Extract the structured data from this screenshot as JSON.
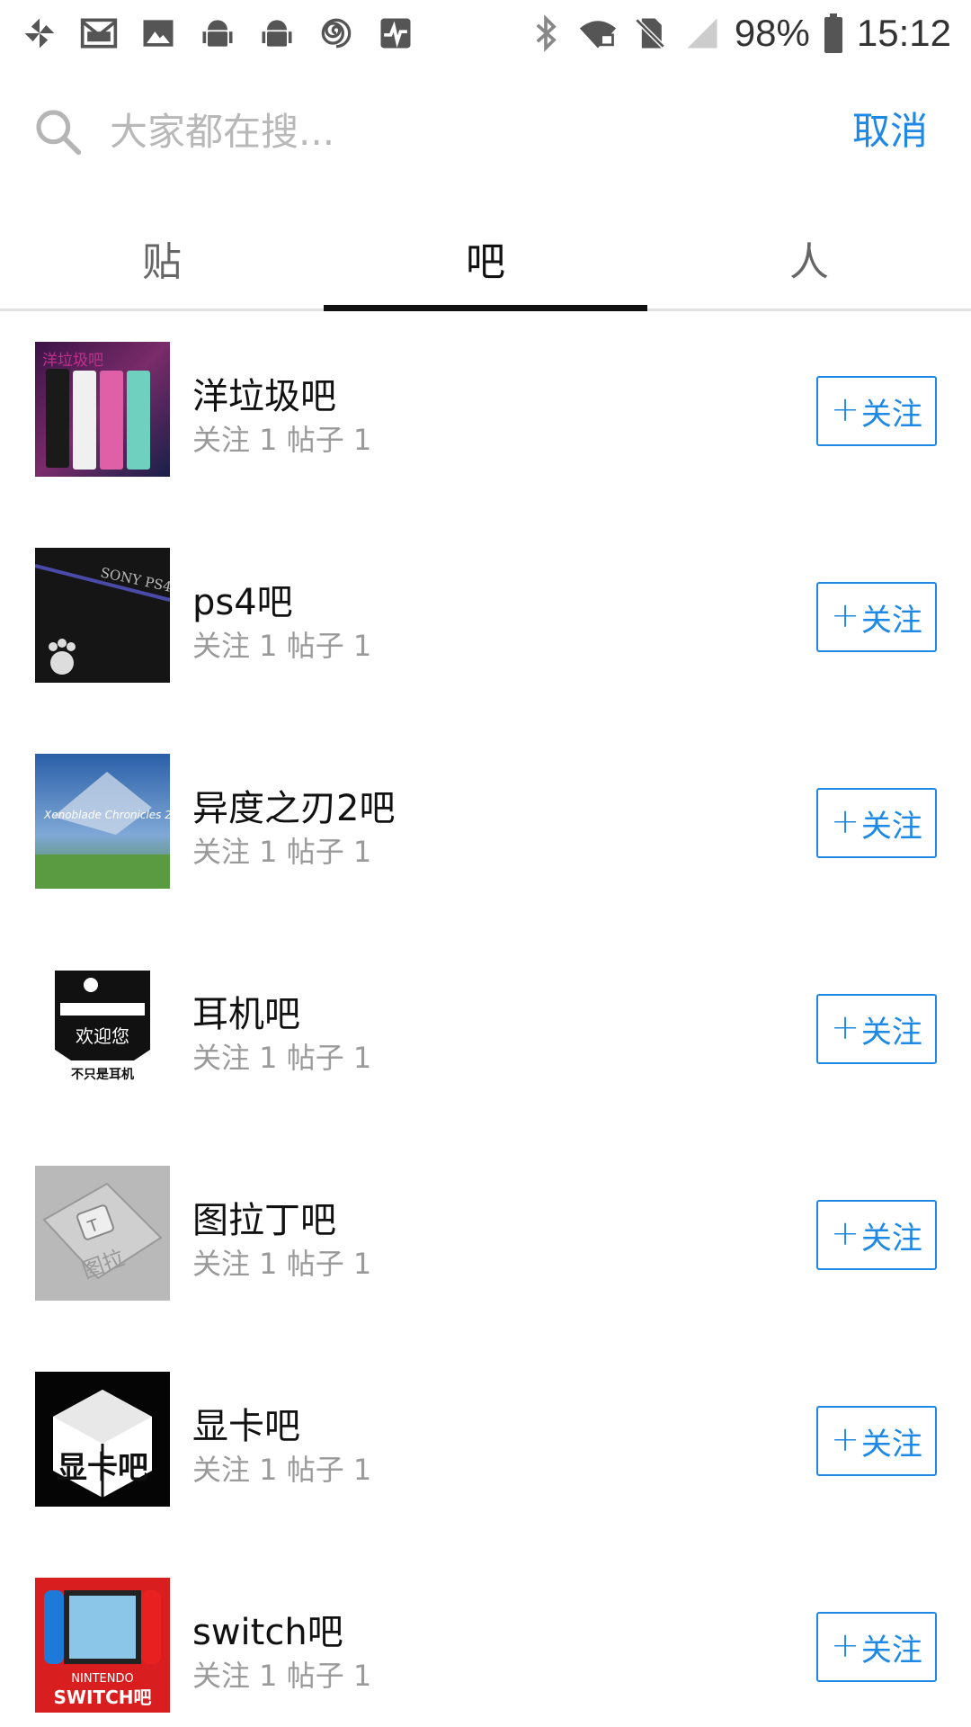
{
  "status_bar": {
    "left_icons": [
      "pinwheel-icon",
      "mail-icon",
      "image-icon",
      "android-icon",
      "android-icon",
      "spiral-icon",
      "pulse-icon"
    ],
    "right_icons": [
      "bluetooth-icon",
      "wifi-lock-icon",
      "no-sim-icon",
      "signal-icon",
      "battery-icon"
    ],
    "battery": "98%",
    "time": "15:12"
  },
  "search": {
    "placeholder": "大家都在搜...",
    "cancel_label": "取消"
  },
  "tabs": [
    {
      "label": "贴",
      "active": false
    },
    {
      "label": "吧",
      "active": true
    },
    {
      "label": "人",
      "active": false
    }
  ],
  "results": [
    {
      "name": "洋垃圾吧",
      "meta": "关注 1 帖子 1",
      "follow": "关注",
      "thumb_label": "洋垃圾吧",
      "icon": "phones-thumbnail"
    },
    {
      "name": "ps4吧",
      "meta": "关注 1 帖子 1",
      "follow": "关注",
      "thumb_label": "SONY PS4",
      "icon": "ps4-thumbnail"
    },
    {
      "name": "异度之刃2吧",
      "meta": "关注 1 帖子 1",
      "follow": "关注",
      "thumb_label": "Xenoblade Chronicles 2",
      "icon": "xenoblade-thumbnail"
    },
    {
      "name": "耳机吧",
      "meta": "关注 1 帖子 1",
      "follow": "关注",
      "thumb_label": "欢迎您",
      "thumb_sub": "不只是耳机",
      "icon": "headphone-thumbnail"
    },
    {
      "name": "图拉丁吧",
      "meta": "关注 1 帖子 1",
      "follow": "关注",
      "thumb_label": "图拉",
      "icon": "tualatin-thumbnail"
    },
    {
      "name": "显卡吧",
      "meta": "关注 1 帖子 1",
      "follow": "关注",
      "thumb_label": "显卡吧",
      "icon": "gpu-thumbnail"
    },
    {
      "name": "switch吧",
      "meta": "关注 1 帖子 1",
      "follow": "关注",
      "thumb_label": "NINTENDO",
      "thumb_sub": "SWITCH吧",
      "icon": "switch-thumbnail"
    }
  ],
  "colors": {
    "accent": "#1e88e5",
    "text": "#111111",
    "meta": "#9a9a9a",
    "placeholder": "#b8b8b8",
    "divider": "#e2e2e2"
  }
}
